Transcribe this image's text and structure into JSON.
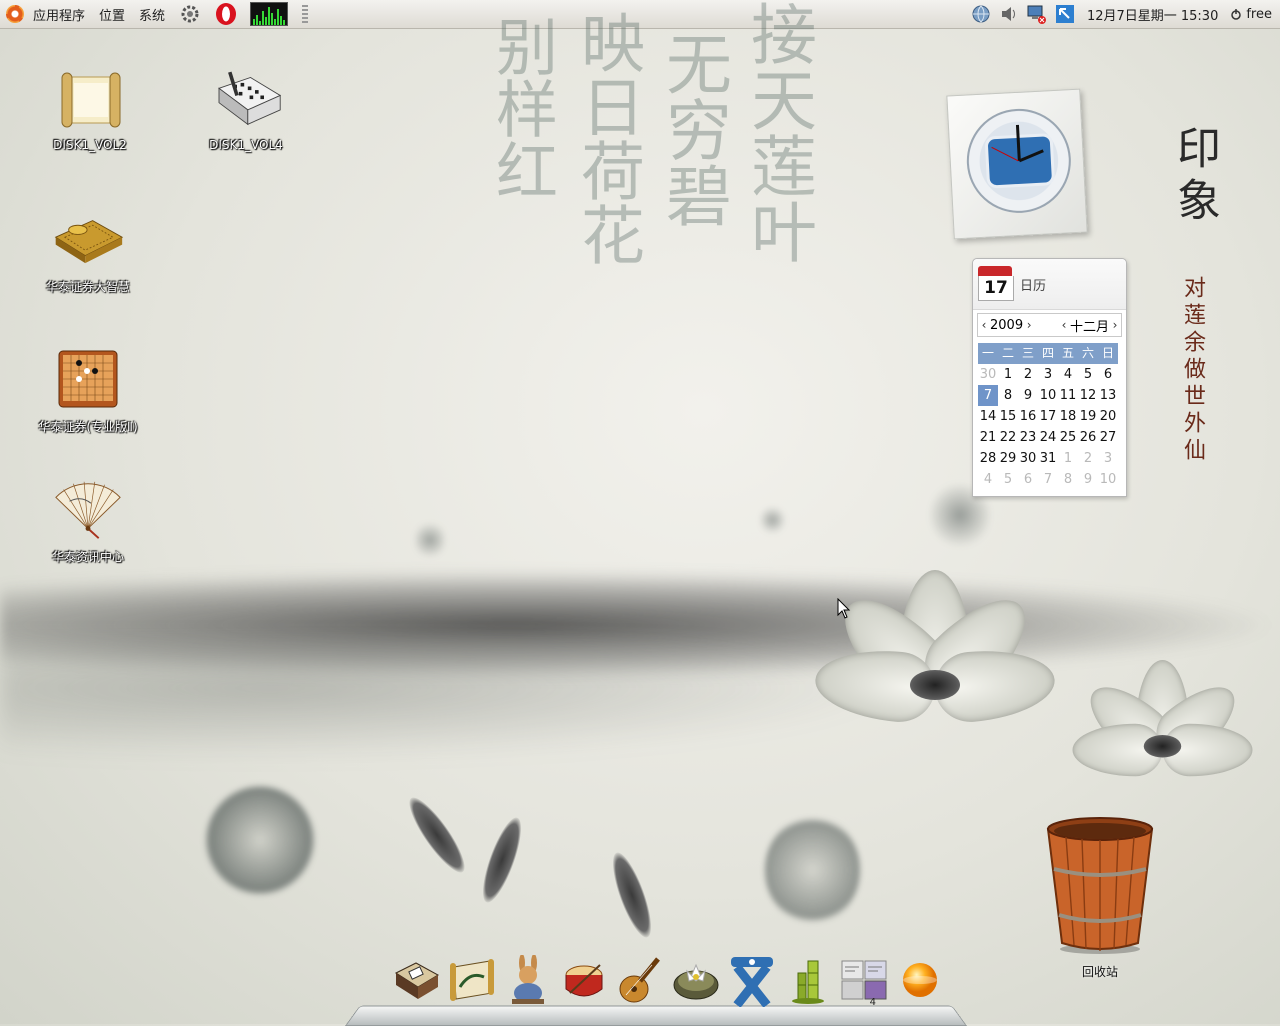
{
  "top_panel": {
    "menus": [
      {
        "label": "应用程序"
      },
      {
        "label": "位置"
      },
      {
        "label": "系统"
      }
    ],
    "clock": "12月7日星期一 15:30",
    "user": "free"
  },
  "desktop_icons": [
    {
      "label": "DISK1_VOL2",
      "icon": "scroll-icon"
    },
    {
      "label": "DISK1_VOL4",
      "icon": "notebook-pen-icon"
    },
    {
      "label": "华泰证券大智慧",
      "icon": "golden-board-icon"
    },
    {
      "label": "华泰证券(专业版Ⅱ)",
      "icon": "go-board-icon"
    },
    {
      "label": "华泰资讯中心",
      "icon": "folding-fan-icon"
    }
  ],
  "calendar": {
    "title": "日历",
    "icon_day": "17",
    "year": "2009",
    "month": "十二月",
    "weekdays": [
      "一",
      "二",
      "三",
      "四",
      "五",
      "六",
      "日"
    ],
    "weeks": [
      [
        "30",
        "1",
        "2",
        "3",
        "4",
        "5",
        "6"
      ],
      [
        "7",
        "8",
        "9",
        "10",
        "11",
        "12",
        "13"
      ],
      [
        "14",
        "15",
        "16",
        "17",
        "18",
        "19",
        "20"
      ],
      [
        "21",
        "22",
        "23",
        "24",
        "25",
        "26",
        "27"
      ],
      [
        "28",
        "29",
        "30",
        "31",
        "1",
        "2",
        "3"
      ],
      [
        "4",
        "5",
        "6",
        "7",
        "8",
        "9",
        "10"
      ]
    ],
    "today": "7"
  },
  "trash": {
    "label": "回收站"
  },
  "wallpaper": {
    "calligraphy": [
      "接天莲叶",
      "无穷碧",
      "映日荷花",
      "别样红"
    ],
    "seal_title": "印象",
    "seal_subtitle": "对莲余做世外仙"
  },
  "dock_items": [
    {
      "icon": "mahjong-box-icon"
    },
    {
      "icon": "scroll-painting-icon"
    },
    {
      "icon": "rabbit-figure-icon"
    },
    {
      "icon": "drum-icon"
    },
    {
      "icon": "pipa-lute-icon"
    },
    {
      "icon": "lotus-bowl-icon"
    },
    {
      "icon": "x-shaped-tool-icon"
    },
    {
      "icon": "bamboo-icon"
    },
    {
      "icon": "workspace-switcher-icon",
      "badge": "4"
    },
    {
      "icon": "orange-orb-icon"
    }
  ],
  "colors": {
    "calendar_header": "#7f9fc9",
    "calendar_today": "#6f94c9",
    "panel_bg": "#e8e6e1"
  }
}
